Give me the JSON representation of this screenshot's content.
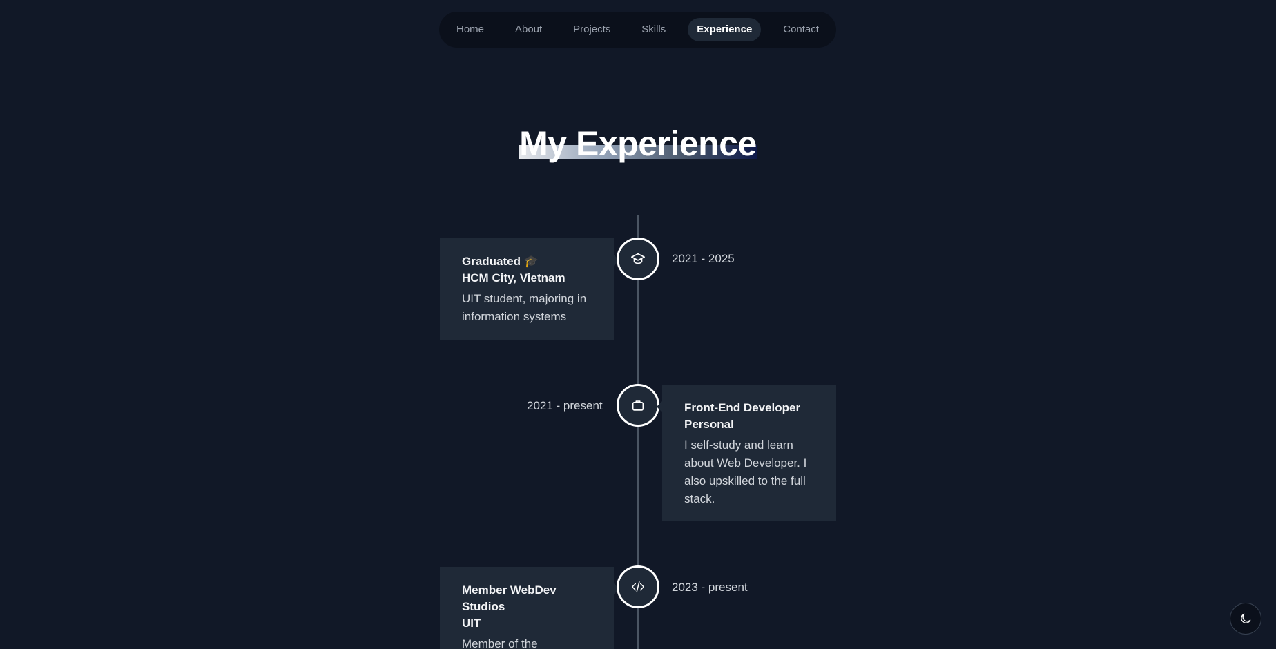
{
  "nav": {
    "items": [
      {
        "label": "Home"
      },
      {
        "label": "About"
      },
      {
        "label": "Projects"
      },
      {
        "label": "Skills"
      },
      {
        "label": "Experience",
        "active": true
      },
      {
        "label": "Contact"
      }
    ]
  },
  "page": {
    "title": "My Experience"
  },
  "timeline": [
    {
      "icon": "graduation-cap-icon",
      "title": "Graduated 🎓",
      "subtitle": "HCM City, Vietnam",
      "description": "UIT student, majoring in information systems",
      "date": "2021 - 2025"
    },
    {
      "icon": "briefcase-icon",
      "title": "Front-End Developer",
      "subtitle": "Personal",
      "description": "I self-study and learn about Web Developer. I also upskilled to the full stack.",
      "date": "2021 - present"
    },
    {
      "icon": "code-icon",
      "title": "Member WebDev Studios",
      "subtitle": "UIT",
      "description": "Member of the",
      "date": "2023 - present"
    }
  ],
  "theme_toggle": {
    "icon": "moon-icon"
  },
  "colors": {
    "background": "#111827",
    "card": "#1f2937",
    "nav": "#0b101b",
    "line": "#4b5563",
    "active_nav": "#1f2937"
  }
}
